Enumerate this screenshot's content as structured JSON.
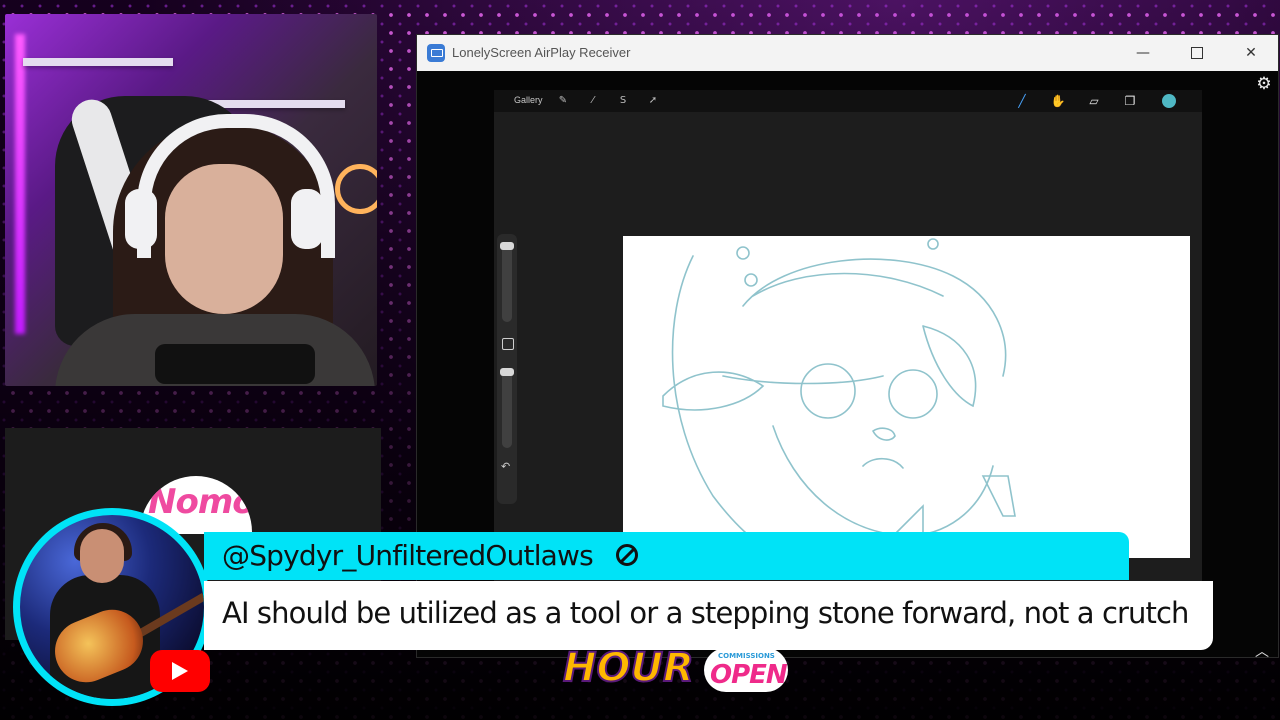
{
  "window": {
    "title": "LonelyScreen AirPlay Receiver",
    "minimize_glyph": "—",
    "close_glyph": "✕"
  },
  "procreate": {
    "gallery_label": "Gallery",
    "tools": [
      "wrench-icon",
      "magic-wand-icon",
      "selection-icon",
      "transform-icon"
    ],
    "right_tools": [
      "brush-icon",
      "smudge-icon",
      "eraser-icon",
      "layers-icon"
    ],
    "current_color": "#4fb8c4"
  },
  "chat": {
    "username": "@Spydyr_UnfilteredOutlaws",
    "message": "AI should be utilized as a tool or a stepping stone forward, not a crutch",
    "accent_color": "#00e3f7",
    "platform": "youtube-icon"
  },
  "overlay": {
    "logo_top": "Nomo",
    "logo_hour": "HOUR",
    "badge_small": "COMMISSIONS",
    "badge_main": "OPEN"
  }
}
